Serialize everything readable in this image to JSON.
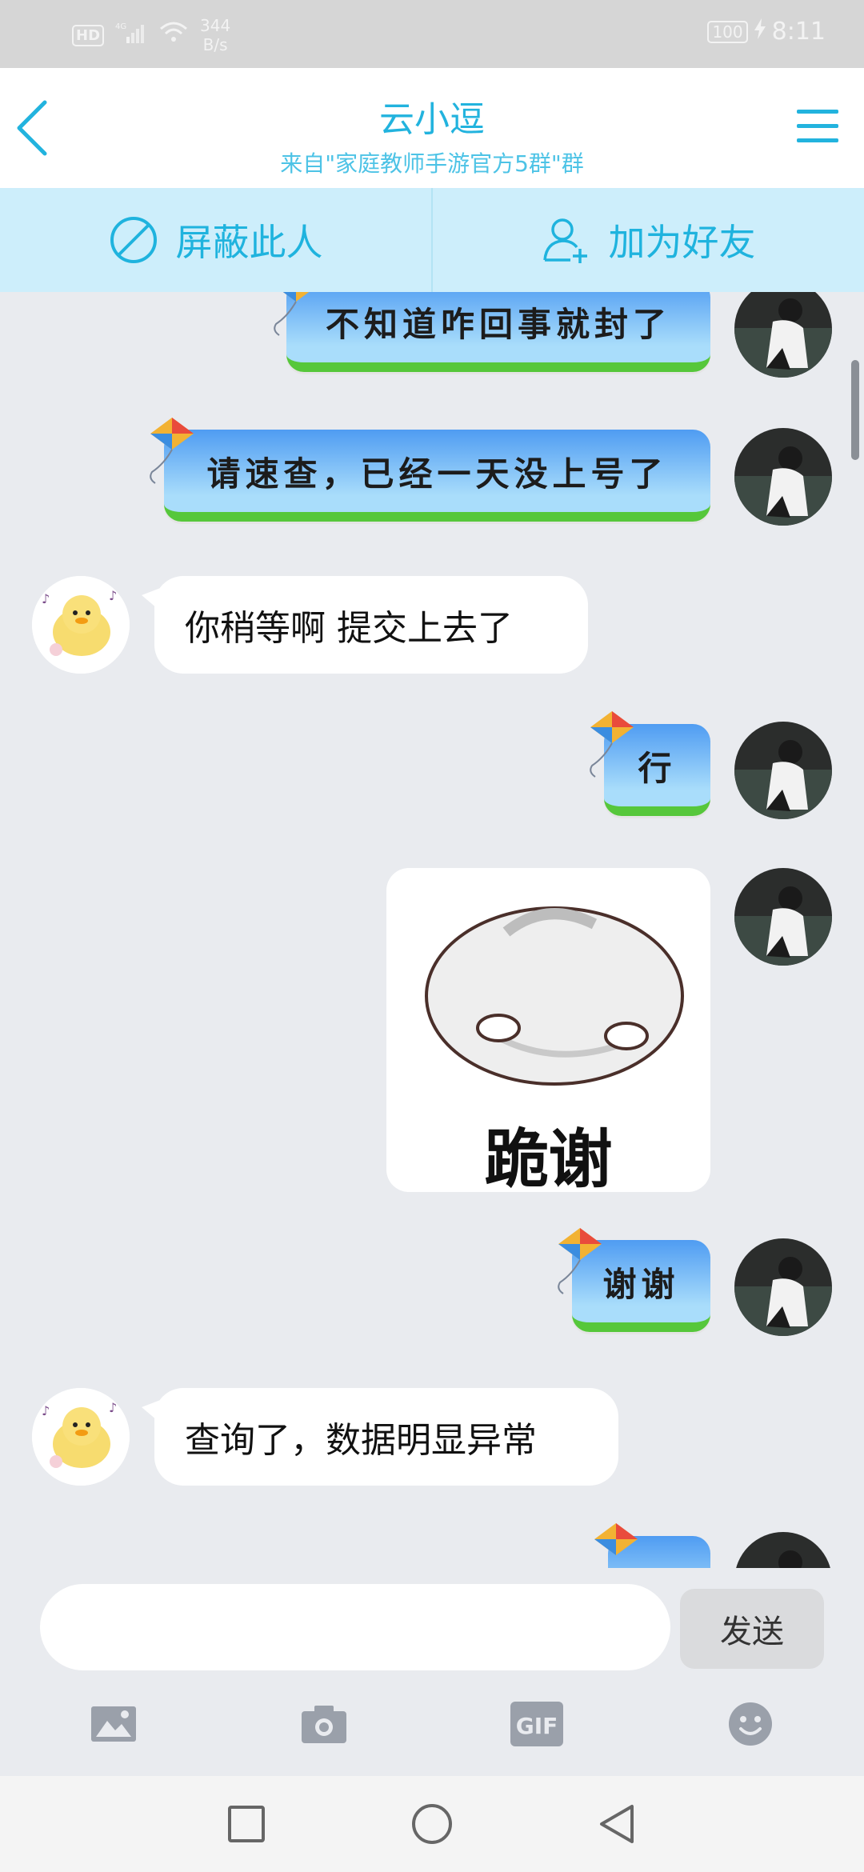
{
  "status_bar": {
    "hd": "HD",
    "network": "4G",
    "speed_value": "344",
    "speed_unit": "B/s",
    "battery": "100",
    "time": "8:11"
  },
  "header": {
    "title": "云小逗",
    "subtitle": "来自\"家庭教师手游官方5群\"群",
    "back_icon": "chevron-left-icon",
    "menu_icon": "hamburger-menu-icon"
  },
  "actions": {
    "block_label": "屏蔽此人",
    "add_friend_label": "加为好友"
  },
  "messages": [
    {
      "side": "right",
      "type": "kite-bubble",
      "text": "不知道咋回事就封了"
    },
    {
      "side": "right",
      "type": "kite-bubble",
      "text": "请速查，已经一天没上号了"
    },
    {
      "side": "left",
      "type": "text",
      "text": "你稍等啊 提交上去了"
    },
    {
      "side": "right",
      "type": "kite-bubble",
      "text": "行"
    },
    {
      "side": "right",
      "type": "sticker",
      "text": "跪谢"
    },
    {
      "side": "right",
      "type": "kite-bubble",
      "text": "谢谢"
    },
    {
      "side": "left",
      "type": "text",
      "text": "查询了，数据明显异常"
    }
  ],
  "composer": {
    "placeholder": "",
    "send_label": "发送"
  },
  "toolbar": [
    "image-icon",
    "camera-icon",
    "gif-icon",
    "emoji-icon"
  ],
  "toolbar_labels": {
    "gif": "GIF"
  },
  "colors": {
    "accent": "#22b3de",
    "action_bar_bg": "#cdeefb",
    "chat_bg": "#e9ebef"
  }
}
